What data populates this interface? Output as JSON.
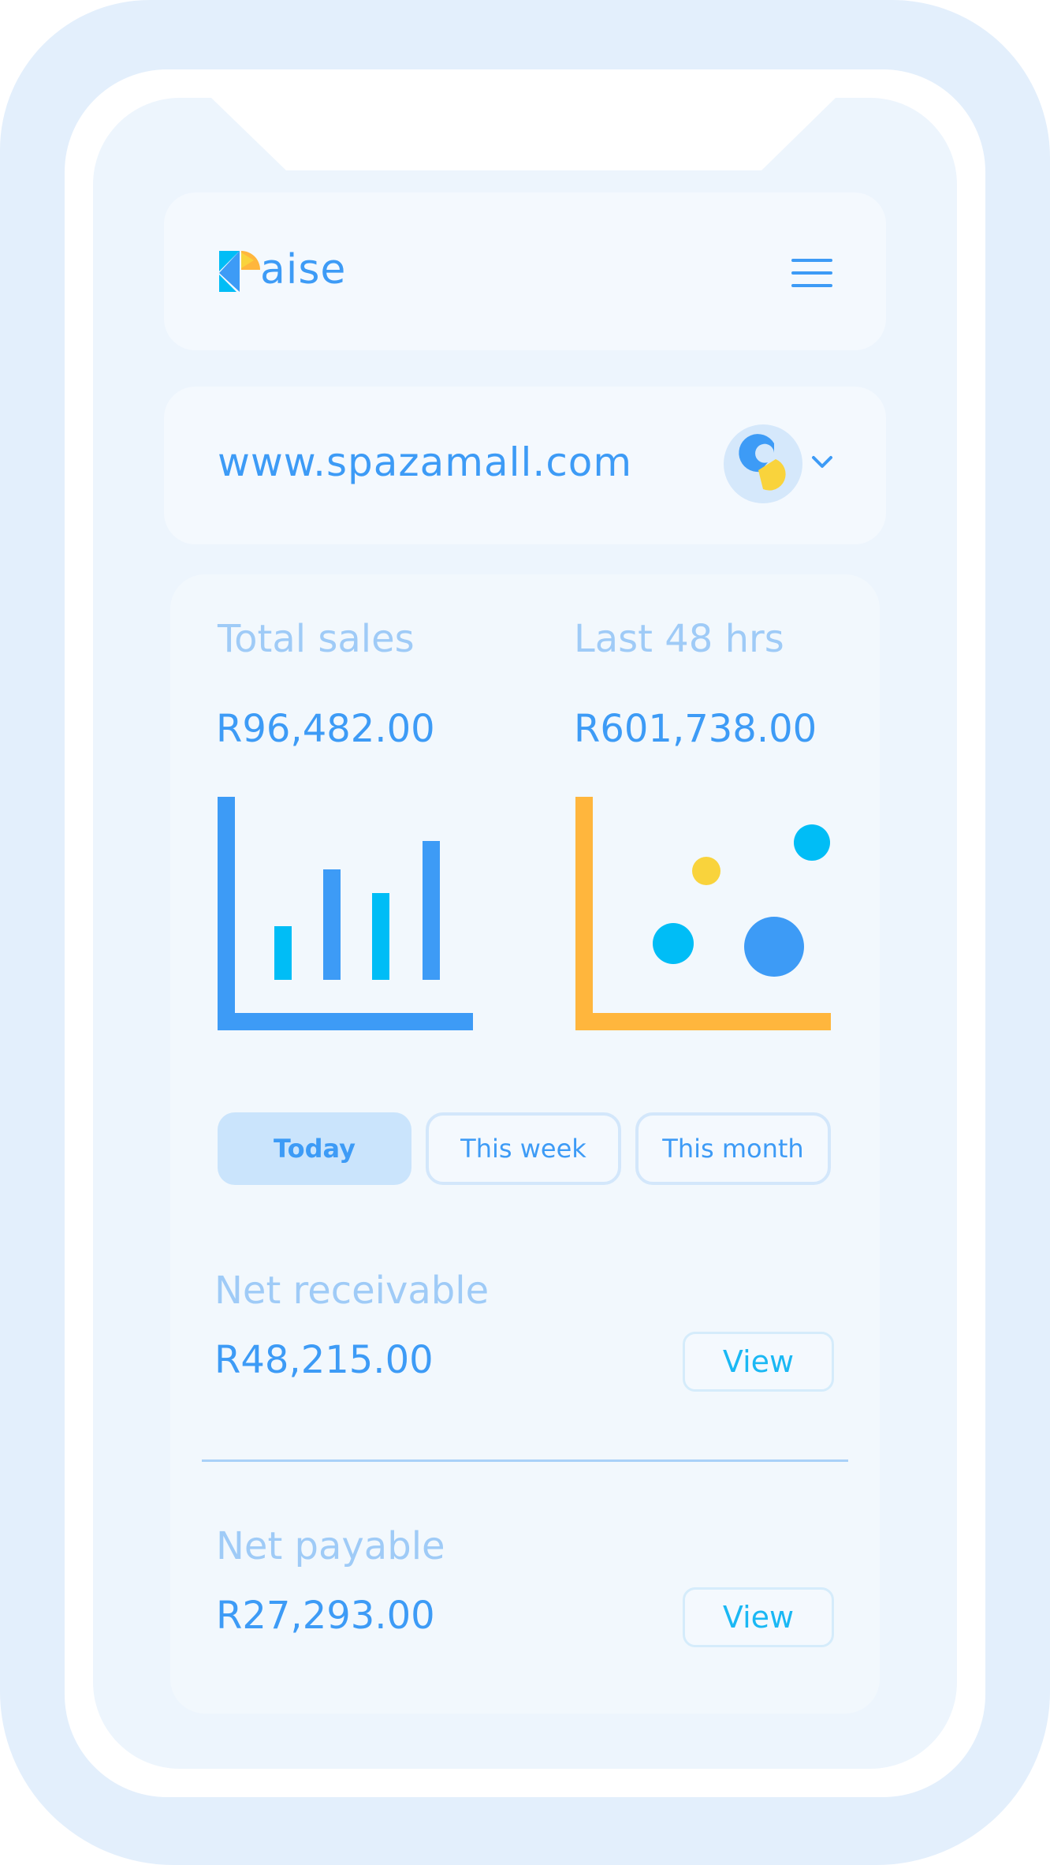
{
  "brand": {
    "logo_text": "aise"
  },
  "header": {
    "menu_icon": "hamburger-menu-icon"
  },
  "site": {
    "url": "www.spazamall.com",
    "avatar_icon": "store-logo-icon",
    "dropdown_icon": "chevron-down-icon"
  },
  "stats": {
    "total_sales_label": "Total sales",
    "total_sales_value": "R96,482.00",
    "last48_label": "Last 48 hrs",
    "last48_value": "R601,738.00"
  },
  "tabs": [
    {
      "label": "Today",
      "active": true
    },
    {
      "label": "This week",
      "active": false
    },
    {
      "label": "This month",
      "active": false
    }
  ],
  "net_receivable": {
    "label": "Net receivable",
    "value": "R48,215.00",
    "button": "View"
  },
  "net_payable": {
    "label": "Net payable",
    "value": "R27,293.00",
    "button": "View"
  },
  "colors": {
    "primary": "#3d9bf6",
    "cyan": "#00bdf6",
    "orange": "#ffb63d",
    "yellow": "#f9d33c",
    "muted_label": "#9fcbf7"
  }
}
